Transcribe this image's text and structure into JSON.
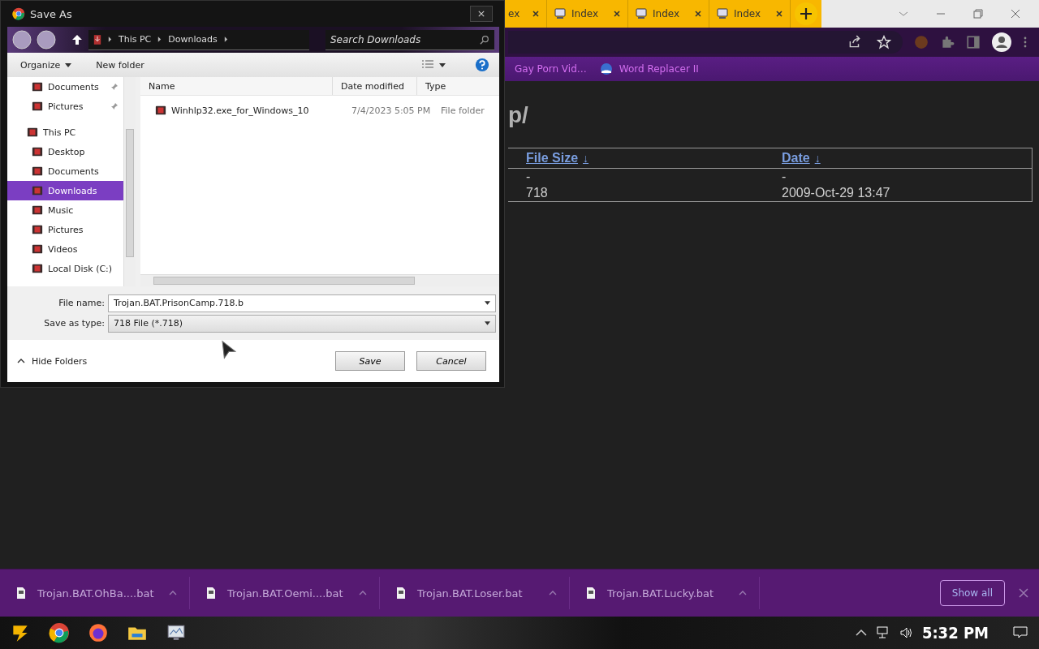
{
  "browser": {
    "tabs": [
      {
        "label": "ex",
        "selected": false
      },
      {
        "label": "Index",
        "selected": false
      },
      {
        "label": "Index",
        "selected": false
      },
      {
        "label": "Index",
        "selected": false
      }
    ],
    "bookmarks": [
      "Gay Porn Vid…",
      "Word Replacer II"
    ],
    "page": {
      "heading": "p/",
      "table": {
        "columns": [
          {
            "label": "File Size",
            "sort": "↓"
          },
          {
            "label": "Date",
            "sort": "↓"
          }
        ],
        "rows": [
          [
            "-",
            "-"
          ],
          [
            "718",
            "2009-Oct-29 13:47"
          ]
        ]
      }
    },
    "downloads": [
      "Trojan.BAT.OhBa....bat",
      "Trojan.BAT.Oemi....bat",
      "Trojan.BAT.Loser.bat",
      "Trojan.BAT.Lucky.bat"
    ],
    "show_all": "Show all"
  },
  "dialog": {
    "title": "Save As",
    "breadcrumb": [
      "This PC",
      "Downloads"
    ],
    "search": {
      "placeholder": "Search Downloads"
    },
    "toolbar": {
      "organize": "Organize",
      "new_folder": "New folder"
    },
    "sidebar": [
      {
        "label": "Documents",
        "pinned": true,
        "selected": false
      },
      {
        "label": "Pictures",
        "pinned": true,
        "selected": false
      },
      {
        "label": "This PC",
        "pinned": false,
        "selected": false,
        "children": [
          {
            "label": "Desktop",
            "pinned": false,
            "selected": false
          },
          {
            "label": "Documents",
            "pinned": false,
            "selected": false
          },
          {
            "label": "Downloads",
            "pinned": false,
            "selected": true
          },
          {
            "label": "Music",
            "pinned": false,
            "selected": false
          },
          {
            "label": "Pictures",
            "pinned": false,
            "selected": false
          },
          {
            "label": "Videos",
            "pinned": false,
            "selected": false
          },
          {
            "label": "Local Disk (C:)",
            "pinned": false,
            "selected": false
          }
        ]
      }
    ],
    "columns": [
      "Name",
      "Date modified",
      "Type"
    ],
    "files": [
      {
        "name": "Winhlp32.exe_for_Windows_10",
        "date": "7/4/2023 5:05 PM",
        "type": "File folder"
      }
    ],
    "file_name": {
      "label": "File name:",
      "value": "Trojan.BAT.PrisonCamp.718.b"
    },
    "save_type": {
      "label": "Save as type:",
      "value": "718 File (*.718)"
    },
    "hide_folders": "Hide Folders",
    "buttons": [
      "Save",
      "Cancel"
    ]
  },
  "taskbar": {
    "time": "5:32 PM"
  }
}
